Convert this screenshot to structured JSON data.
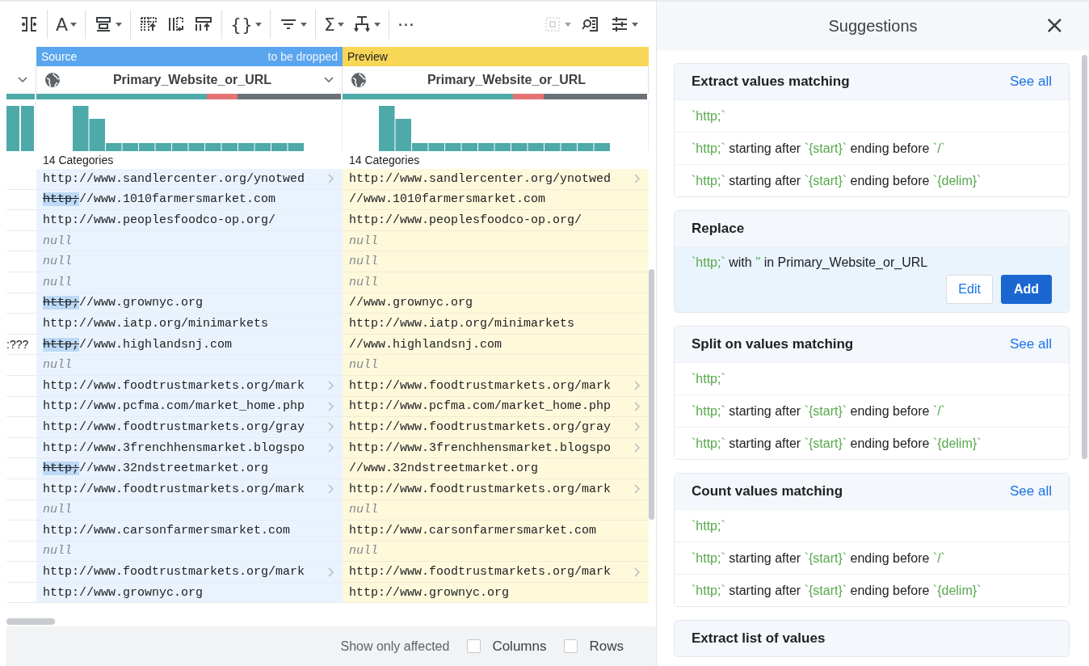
{
  "toolbar": {
    "groups": [
      [
        {
          "kind": "split-columns",
          "dropdown": false,
          "disabled": false
        }
      ],
      [
        {
          "kind": "text",
          "glyph": "A",
          "dropdown": true,
          "disabled": false
        }
      ],
      [
        {
          "kind": "rows",
          "dropdown": true,
          "disabled": false
        }
      ],
      [
        {
          "kind": "table-up",
          "dropdown": false,
          "disabled": false
        },
        {
          "kind": "table-columns",
          "dropdown": false,
          "disabled": false
        },
        {
          "kind": "table-sort",
          "dropdown": false,
          "disabled": false
        }
      ],
      [
        {
          "kind": "text",
          "glyph": "{}",
          "dropdown": true,
          "disabled": false
        }
      ],
      [
        {
          "kind": "filter",
          "dropdown": true,
          "disabled": false
        }
      ],
      [
        {
          "kind": "text",
          "glyph": "Σ",
          "dropdown": true,
          "disabled": false
        },
        {
          "kind": "merge",
          "dropdown": true,
          "disabled": false
        }
      ],
      [
        {
          "kind": "text",
          "glyph": "···",
          "dropdown": false,
          "disabled": false
        }
      ]
    ],
    "right": [
      {
        "kind": "select-box",
        "dropdown": true,
        "disabled": true
      },
      {
        "kind": "search-doc",
        "dropdown": false,
        "disabled": false
      },
      {
        "kind": "sliders",
        "dropdown": true,
        "disabled": false
      }
    ]
  },
  "grid": {
    "source": {
      "label": "Source",
      "note": "to be dropped",
      "column": "Primary_Website_or_URL",
      "categories": "14 Categories"
    },
    "preview": {
      "label": "Preview",
      "column": "Primary_Website_or_URL",
      "categories": "14 Categories"
    },
    "rows": [
      {
        "source": {
          "kind": "text",
          "text": "http://www.sandlercenter.org/ynotwed",
          "overflow": true
        },
        "preview": {
          "kind": "text",
          "text": "http://www.sandlercenter.org/ynotwed",
          "overflow": true
        }
      },
      {
        "source": {
          "kind": "edited",
          "removed": "http;",
          "text": "//www.1010farmersmarket.com",
          "overflow": false
        },
        "preview": {
          "kind": "text",
          "text": "//www.1010farmersmarket.com",
          "overflow": false
        }
      },
      {
        "source": {
          "kind": "text",
          "text": "http://www.peoplesfoodco-op.org/",
          "overflow": false
        },
        "preview": {
          "kind": "text",
          "text": "http://www.peoplesfoodco-op.org/",
          "overflow": false
        }
      },
      {
        "source": {
          "kind": "null",
          "text": "null",
          "overflow": false
        },
        "preview": {
          "kind": "null",
          "text": "null",
          "overflow": false
        }
      },
      {
        "source": {
          "kind": "null",
          "text": "null",
          "overflow": false
        },
        "preview": {
          "kind": "null",
          "text": "null",
          "overflow": false
        }
      },
      {
        "source": {
          "kind": "null",
          "text": "null",
          "overflow": false
        },
        "preview": {
          "kind": "null",
          "text": "null",
          "overflow": false
        }
      },
      {
        "source": {
          "kind": "edited",
          "removed": "http;",
          "text": "//www.grownyc.org",
          "overflow": false
        },
        "preview": {
          "kind": "text",
          "text": "//www.grownyc.org",
          "overflow": false
        }
      },
      {
        "source": {
          "kind": "text",
          "text": "http://www.iatp.org/minimarkets",
          "overflow": false
        },
        "preview": {
          "kind": "text",
          "text": "http://www.iatp.org/minimarkets",
          "overflow": false
        }
      },
      {
        "stub": ":???",
        "source": {
          "kind": "edited",
          "removed": "http;",
          "text": "//www.highlandsnj.com",
          "overflow": false
        },
        "preview": {
          "kind": "text",
          "text": "//www.highlandsnj.com",
          "overflow": false
        }
      },
      {
        "source": {
          "kind": "null",
          "text": "null",
          "overflow": false
        },
        "preview": {
          "kind": "null",
          "text": "null",
          "overflow": false
        }
      },
      {
        "source": {
          "kind": "text",
          "text": "http://www.foodtrustmarkets.org/mark",
          "overflow": true
        },
        "preview": {
          "kind": "text",
          "text": "http://www.foodtrustmarkets.org/mark",
          "overflow": true
        }
      },
      {
        "source": {
          "kind": "text",
          "text": "http://www.pcfma.com/market_home.php",
          "overflow": true
        },
        "preview": {
          "kind": "text",
          "text": "http://www.pcfma.com/market_home.php",
          "overflow": true
        }
      },
      {
        "source": {
          "kind": "text",
          "text": "http://www.foodtrustmarkets.org/gray",
          "overflow": true
        },
        "preview": {
          "kind": "text",
          "text": "http://www.foodtrustmarkets.org/gray",
          "overflow": true
        }
      },
      {
        "source": {
          "kind": "text",
          "text": "http://www.3frenchhensmarket.blogspo",
          "overflow": true
        },
        "preview": {
          "kind": "text",
          "text": "http://www.3frenchhensmarket.blogspo",
          "overflow": true
        }
      },
      {
        "source": {
          "kind": "edited",
          "removed": "http;",
          "text": "//www.32ndstreetmarket.org",
          "overflow": false
        },
        "preview": {
          "kind": "text",
          "text": "//www.32ndstreetmarket.org",
          "overflow": false
        }
      },
      {
        "source": {
          "kind": "text",
          "text": "http://www.foodtrustmarkets.org/mark",
          "overflow": true
        },
        "preview": {
          "kind": "text",
          "text": "http://www.foodtrustmarkets.org/mark",
          "overflow": true
        }
      },
      {
        "source": {
          "kind": "null",
          "text": "null",
          "overflow": false
        },
        "preview": {
          "kind": "null",
          "text": "null",
          "overflow": false
        }
      },
      {
        "source": {
          "kind": "text",
          "text": "http://www.carsonfarmersmarket.com",
          "overflow": false
        },
        "preview": {
          "kind": "text",
          "text": "http://www.carsonfarmersmarket.com",
          "overflow": false
        }
      },
      {
        "source": {
          "kind": "null",
          "text": "null",
          "overflow": false
        },
        "preview": {
          "kind": "null",
          "text": "null",
          "overflow": false
        }
      },
      {
        "source": {
          "kind": "text",
          "text": "http://www.foodtrustmarkets.org/mark",
          "overflow": true
        },
        "preview": {
          "kind": "text",
          "text": "http://www.foodtrustmarkets.org/mark",
          "overflow": true
        }
      },
      {
        "source": {
          "kind": "text",
          "text": "http://www.grownyc.org",
          "overflow": false
        },
        "preview": {
          "kind": "text",
          "text": "http://www.grownyc.org",
          "overflow": false
        }
      }
    ]
  },
  "footer": {
    "label": "Show only affected",
    "options": [
      {
        "label": "Columns",
        "checked": false
      },
      {
        "label": "Rows",
        "checked": false
      }
    ]
  },
  "panel": {
    "title": "Suggestions",
    "close": "×",
    "cards": [
      {
        "title": "Extract values matching",
        "link": "See all",
        "items": [
          {
            "selected": false,
            "parts": [
              {
                "kind": "code",
                "text": "`http;`"
              }
            ]
          },
          {
            "selected": false,
            "parts": [
              {
                "kind": "code",
                "text": "`http;`"
              },
              {
                "kind": "plain",
                "text": " starting after "
              },
              {
                "kind": "code",
                "text": "`{start}`"
              },
              {
                "kind": "plain",
                "text": " ending before "
              },
              {
                "kind": "code",
                "text": "`/`"
              }
            ]
          },
          {
            "selected": false,
            "parts": [
              {
                "kind": "code",
                "text": "`http;`"
              },
              {
                "kind": "plain",
                "text": " starting after "
              },
              {
                "kind": "code",
                "text": "`{start}`"
              },
              {
                "kind": "plain",
                "text": " ending before "
              },
              {
                "kind": "code",
                "text": "`{delim}`"
              }
            ]
          }
        ]
      },
      {
        "title": "Replace",
        "items": [
          {
            "selected": true,
            "parts": [
              {
                "kind": "code",
                "text": "`http;`"
              },
              {
                "kind": "plain",
                "text": " with "
              },
              {
                "kind": "code",
                "text": "''"
              },
              {
                "kind": "plain",
                "text": " in Primary_Website_or_URL"
              }
            ],
            "buttons": [
              {
                "label": "Edit",
                "primary": false
              },
              {
                "label": "Add",
                "primary": true
              }
            ]
          }
        ]
      },
      {
        "title": "Split on values matching",
        "link": "See all",
        "items": [
          {
            "selected": false,
            "parts": [
              {
                "kind": "code",
                "text": "`http;`"
              }
            ]
          },
          {
            "selected": false,
            "parts": [
              {
                "kind": "code",
                "text": "`http;`"
              },
              {
                "kind": "plain",
                "text": " starting after "
              },
              {
                "kind": "code",
                "text": "`{start}`"
              },
              {
                "kind": "plain",
                "text": " ending before "
              },
              {
                "kind": "code",
                "text": "`/`"
              }
            ]
          },
          {
            "selected": false,
            "parts": [
              {
                "kind": "code",
                "text": "`http;`"
              },
              {
                "kind": "plain",
                "text": " starting after "
              },
              {
                "kind": "code",
                "text": "`{start}`"
              },
              {
                "kind": "plain",
                "text": " ending before "
              },
              {
                "kind": "code",
                "text": "`{delim}`"
              }
            ]
          }
        ]
      },
      {
        "title": "Count values matching",
        "link": "See all",
        "items": [
          {
            "selected": false,
            "parts": [
              {
                "kind": "code",
                "text": "`http;`"
              }
            ]
          },
          {
            "selected": false,
            "parts": [
              {
                "kind": "code",
                "text": "`http;`"
              },
              {
                "kind": "plain",
                "text": " starting after "
              },
              {
                "kind": "code",
                "text": "`{start}`"
              },
              {
                "kind": "plain",
                "text": " ending before "
              },
              {
                "kind": "code",
                "text": "`/`"
              }
            ]
          },
          {
            "selected": false,
            "parts": [
              {
                "kind": "code",
                "text": "`http;`"
              },
              {
                "kind": "plain",
                "text": " starting after "
              },
              {
                "kind": "code",
                "text": "`{start}`"
              },
              {
                "kind": "plain",
                "text": " ending before "
              },
              {
                "kind": "code",
                "text": "`{delim}`"
              }
            ]
          }
        ]
      },
      {
        "title": "Extract list of values"
      }
    ]
  }
}
